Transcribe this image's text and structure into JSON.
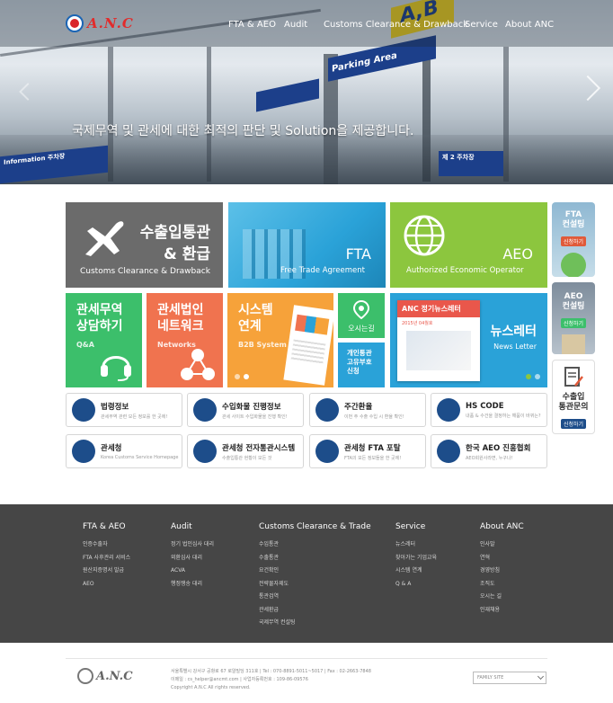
{
  "brand": {
    "logo_text": "A.N.C"
  },
  "nav": {
    "items": [
      "FTA & AEO",
      "Audit",
      "Customs Clearance & Drawback",
      "Service",
      "About ANC"
    ]
  },
  "hero": {
    "caption": "국제무역 및 관세에 대한 최적의 판단 및 Solution을 제공합니다.",
    "signs": {
      "parking": "Parking Area",
      "yellow": "A,B",
      "tag": "제 2 주차장",
      "tag2": "Information 주차장"
    }
  },
  "tiles": {
    "customs": {
      "title_line1": "수출입통관",
      "title_line2": "& 환급",
      "english": "Customs Clearance & Drawback",
      "color": "#6b6b6b"
    },
    "fta": {
      "title": "FTA",
      "english": "Free Trade Agreement",
      "color": "#2aa2d8"
    },
    "aeo": {
      "title": "AEO",
      "english": "Authorized Economic Operator",
      "color": "#8cc63e"
    },
    "qa": {
      "line1": "관세무역",
      "line2": "상담하기",
      "english": "Q&A",
      "color": "#3cbf6b"
    },
    "network": {
      "line1": "관세법인",
      "line2": "네트워크",
      "english": "Networks",
      "color": "#f0734f"
    },
    "system": {
      "line1": "시스템",
      "line2": "연계",
      "english": "B2B System",
      "color": "#f6a23a"
    },
    "location": {
      "label": "오시는길",
      "color": "#3cbf6b"
    },
    "privacy": {
      "line1": "개인통관",
      "line2": "고유부호",
      "line3": "신청",
      "color": "#2aa2d8"
    },
    "newsletter": {
      "title": "뉴스레터",
      "english": "News Letter",
      "card_title": "ANC 정기뉴스레터",
      "card_date": "2015년 04월호",
      "color": "#2aa2d8"
    }
  },
  "side_cards": [
    {
      "line1": "FTA",
      "line2": "컨설팅",
      "badge": "신청하기",
      "badge_color": "#e05a3a"
    },
    {
      "line1": "AEO",
      "line2": "컨설팅",
      "badge": "신청하기",
      "badge_color": "#3cbf6b"
    },
    {
      "line1": "수출입",
      "line2": "통관문의",
      "badge": "신청하기",
      "badge_color": "#1d4d8a"
    }
  ],
  "quick_links": [
    {
      "title": "법령정보",
      "sub": "관세무역 관련 모든 정보를 한 곳에!"
    },
    {
      "title": "수입화물 진행정보",
      "sub": "관세 사이트 수입화물을 진행 확인!"
    },
    {
      "title": "주간환율",
      "sub": "이번 주 수출 수입 시 환율 확인!"
    },
    {
      "title": "HS CODE",
      "sub": "내품 & 수건을 결정하는 해품이 바뀌는?"
    },
    {
      "title": "관세청",
      "sub": "Korea Customs Service Homepage"
    },
    {
      "title": "관세청 전자통관시스템",
      "sub": "수출입통관 현황이 모든 것"
    },
    {
      "title": "관세청 FTA 포탈",
      "sub": "FTA의 모든 정보들을 한 곳에!"
    },
    {
      "title": "한국 AEO 진흥협회",
      "sub": "AEO회원사라면, 누구나!"
    }
  ],
  "footer_nav": [
    {
      "heading": "FTA & AEO",
      "items": [
        "인증수출자",
        "FTA 사후관리 서비스",
        "원산지증명서 발급",
        "AEO"
      ]
    },
    {
      "heading": "Audit",
      "items": [
        "정기 법인심사 대리",
        "외환심사 대리",
        "ACVA",
        "행정쟁송 대리"
      ]
    },
    {
      "heading": "Customs Clearance & Trade",
      "items": [
        "수입통관",
        "수출통관",
        "요건확인",
        "전략물자제도",
        "통관검역",
        "관세환급",
        "국제무역 컨설팅"
      ]
    },
    {
      "heading": "Service",
      "items": [
        "뉴스레터",
        "찾아가는 기업교육",
        "시스템 연계",
        "Q & A"
      ]
    },
    {
      "heading": "About ANC",
      "items": [
        "인사말",
        "연혁",
        "경영방침",
        "조직도",
        "오시는 길",
        "인재채용"
      ]
    }
  ],
  "footer_info": {
    "address": "서울특별시 강서구 공항로 67 로얄빌딩 311호  |  Tel : 070-8891-5011~5017  |  Fax : 02-2663-7848",
    "email": "이메일 : cs_helper@ancmt.com  |  사업자등록번호 : 109-86-09576",
    "copyright": "Copyright A.N.C All rights reserved.",
    "family_site": "FAMILY SITE"
  }
}
